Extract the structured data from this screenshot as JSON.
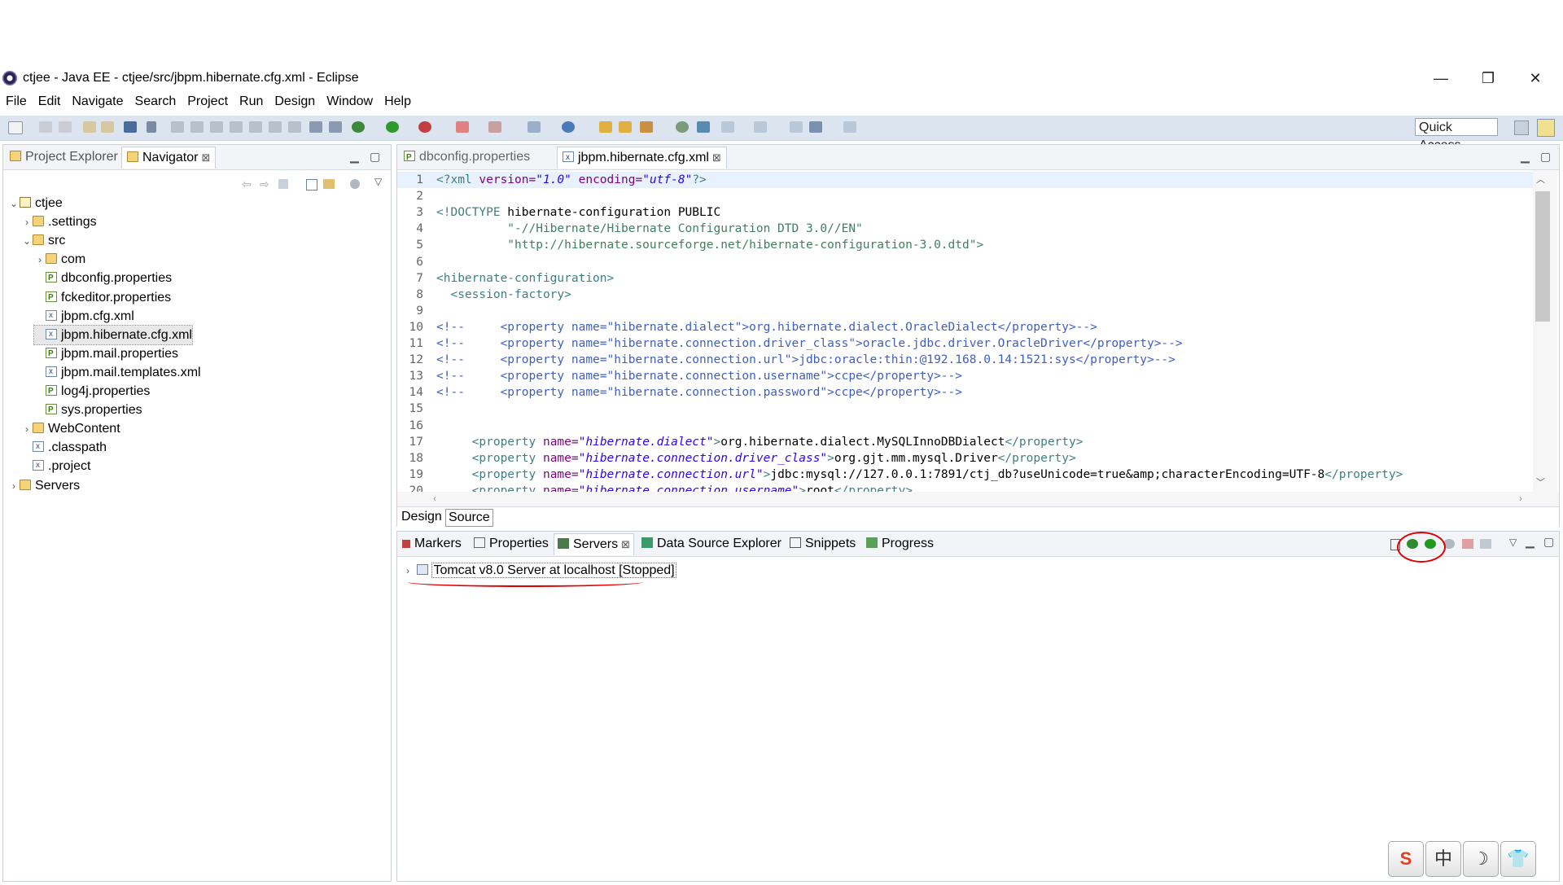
{
  "window": {
    "title": "ctjee - Java EE - ctjee/src/jbpm.hibernate.cfg.xml - Eclipse",
    "minimize": "—",
    "restore": "❐",
    "close": "✕"
  },
  "menu": [
    "File",
    "Edit",
    "Navigate",
    "Search",
    "Project",
    "Run",
    "Design",
    "Window",
    "Help"
  ],
  "toolbar": {
    "quick_access": "Quick Access"
  },
  "left_panel": {
    "tabs": [
      {
        "label": "Project Explorer",
        "active": false
      },
      {
        "label": "Navigator",
        "active": true,
        "close": "⊠"
      }
    ],
    "tree": [
      {
        "label": "ctjee",
        "depth": 0,
        "icon": "project-icon",
        "expanded": true
      },
      {
        "label": ".settings",
        "depth": 1,
        "icon": "folder-icon",
        "expanded": false
      },
      {
        "label": "src",
        "depth": 1,
        "icon": "folder-icon",
        "expanded": true
      },
      {
        "label": "com",
        "depth": 2,
        "icon": "folder-icon",
        "expanded": false
      },
      {
        "label": "dbconfig.properties",
        "depth": 2,
        "icon": "properties-file-icon"
      },
      {
        "label": "fckeditor.properties",
        "depth": 2,
        "icon": "properties-file-icon"
      },
      {
        "label": "jbpm.cfg.xml",
        "depth": 2,
        "icon": "xml-file-icon"
      },
      {
        "label": "jbpm.hibernate.cfg.xml",
        "depth": 2,
        "icon": "xml-file-icon",
        "selected": true
      },
      {
        "label": "jbpm.mail.properties",
        "depth": 2,
        "icon": "properties-file-icon"
      },
      {
        "label": "jbpm.mail.templates.xml",
        "depth": 2,
        "icon": "xml-file-icon"
      },
      {
        "label": "log4j.properties",
        "depth": 2,
        "icon": "properties-file-icon"
      },
      {
        "label": "sys.properties",
        "depth": 2,
        "icon": "properties-file-icon"
      },
      {
        "label": "WebContent",
        "depth": 1,
        "icon": "folder-icon",
        "expanded": false
      },
      {
        "label": ".classpath",
        "depth": 1,
        "icon": "file-icon"
      },
      {
        "label": ".project",
        "depth": 1,
        "icon": "file-icon"
      },
      {
        "label": "Servers",
        "depth": 0,
        "icon": "folder-icon",
        "expanded": false
      }
    ]
  },
  "editor": {
    "tabs": [
      {
        "label": "dbconfig.properties",
        "active": false
      },
      {
        "label": "jbpm.hibernate.cfg.xml",
        "active": true,
        "close": "⊠"
      }
    ],
    "lines": [
      {
        "n": "1",
        "t": "<?xml version=\"1.0\" encoding=\"utf-8\"?>"
      },
      {
        "n": "2",
        "t": ""
      },
      {
        "n": "3",
        "t": "<!DOCTYPE hibernate-configuration PUBLIC"
      },
      {
        "n": "4",
        "t": "          \"-//Hibernate/Hibernate Configuration DTD 3.0//EN\""
      },
      {
        "n": "5",
        "t": "          \"http://hibernate.sourceforge.net/hibernate-configuration-3.0.dtd\">"
      },
      {
        "n": "6",
        "t": ""
      },
      {
        "n": "7",
        "t": "<hibernate-configuration>"
      },
      {
        "n": "8",
        "t": "  <session-factory>"
      },
      {
        "n": "9",
        "t": ""
      },
      {
        "n": "10",
        "t": "<!--     <property name=\"hibernate.dialect\">org.hibernate.dialect.OracleDialect</property>-->"
      },
      {
        "n": "11",
        "t": "<!--     <property name=\"hibernate.connection.driver_class\">oracle.jdbc.driver.OracleDriver</property>-->"
      },
      {
        "n": "12",
        "t": "<!--     <property name=\"hibernate.connection.url\">jdbc:oracle:thin:@192.168.0.14:1521:sys</property>-->"
      },
      {
        "n": "13",
        "t": "<!--     <property name=\"hibernate.connection.username\">ccpe</property>-->"
      },
      {
        "n": "14",
        "t": "<!--     <property name=\"hibernate.connection.password\">ccpe</property>-->"
      },
      {
        "n": "15",
        "t": ""
      },
      {
        "n": "16",
        "t": ""
      },
      {
        "n": "17",
        "t": "     <property name=\"hibernate.dialect\">org.hibernate.dialect.MySQLInnoDBDialect</property>"
      },
      {
        "n": "18",
        "t": "     <property name=\"hibernate.connection.driver_class\">org.gjt.mm.mysql.Driver</property>"
      },
      {
        "n": "19",
        "t": "     <property name=\"hibernate.connection.url\">jdbc:mysql://127.0.0.1:7891/ctj_db?useUnicode=true&amp;characterEncoding=UTF-8</property>"
      },
      {
        "n": "20",
        "t": "     <property name=\"hibernate.connection.username\">root</property>"
      }
    ],
    "bottom_tabs": [
      "Design",
      "Source"
    ]
  },
  "bottom_panel": {
    "tabs": [
      {
        "label": "Markers",
        "icon": "markers-icon"
      },
      {
        "label": "Properties",
        "icon": "properties-view-icon"
      },
      {
        "label": "Servers",
        "icon": "servers-icon",
        "active": true,
        "close": "⊠"
      },
      {
        "label": "Data Source Explorer",
        "icon": "data-source-icon"
      },
      {
        "label": "Snippets",
        "icon": "snippets-icon"
      },
      {
        "label": "Progress",
        "icon": "progress-icon"
      }
    ],
    "server_entry": "Tomcat v8.0 Server at localhost  [Stopped]"
  },
  "ime": {
    "buttons": [
      "S",
      "中",
      "☽",
      "👕"
    ]
  },
  "colors": {
    "toolbar_bg": "#dbe4ef",
    "annotation": "#e00000",
    "selection": "#e8e8e8"
  }
}
